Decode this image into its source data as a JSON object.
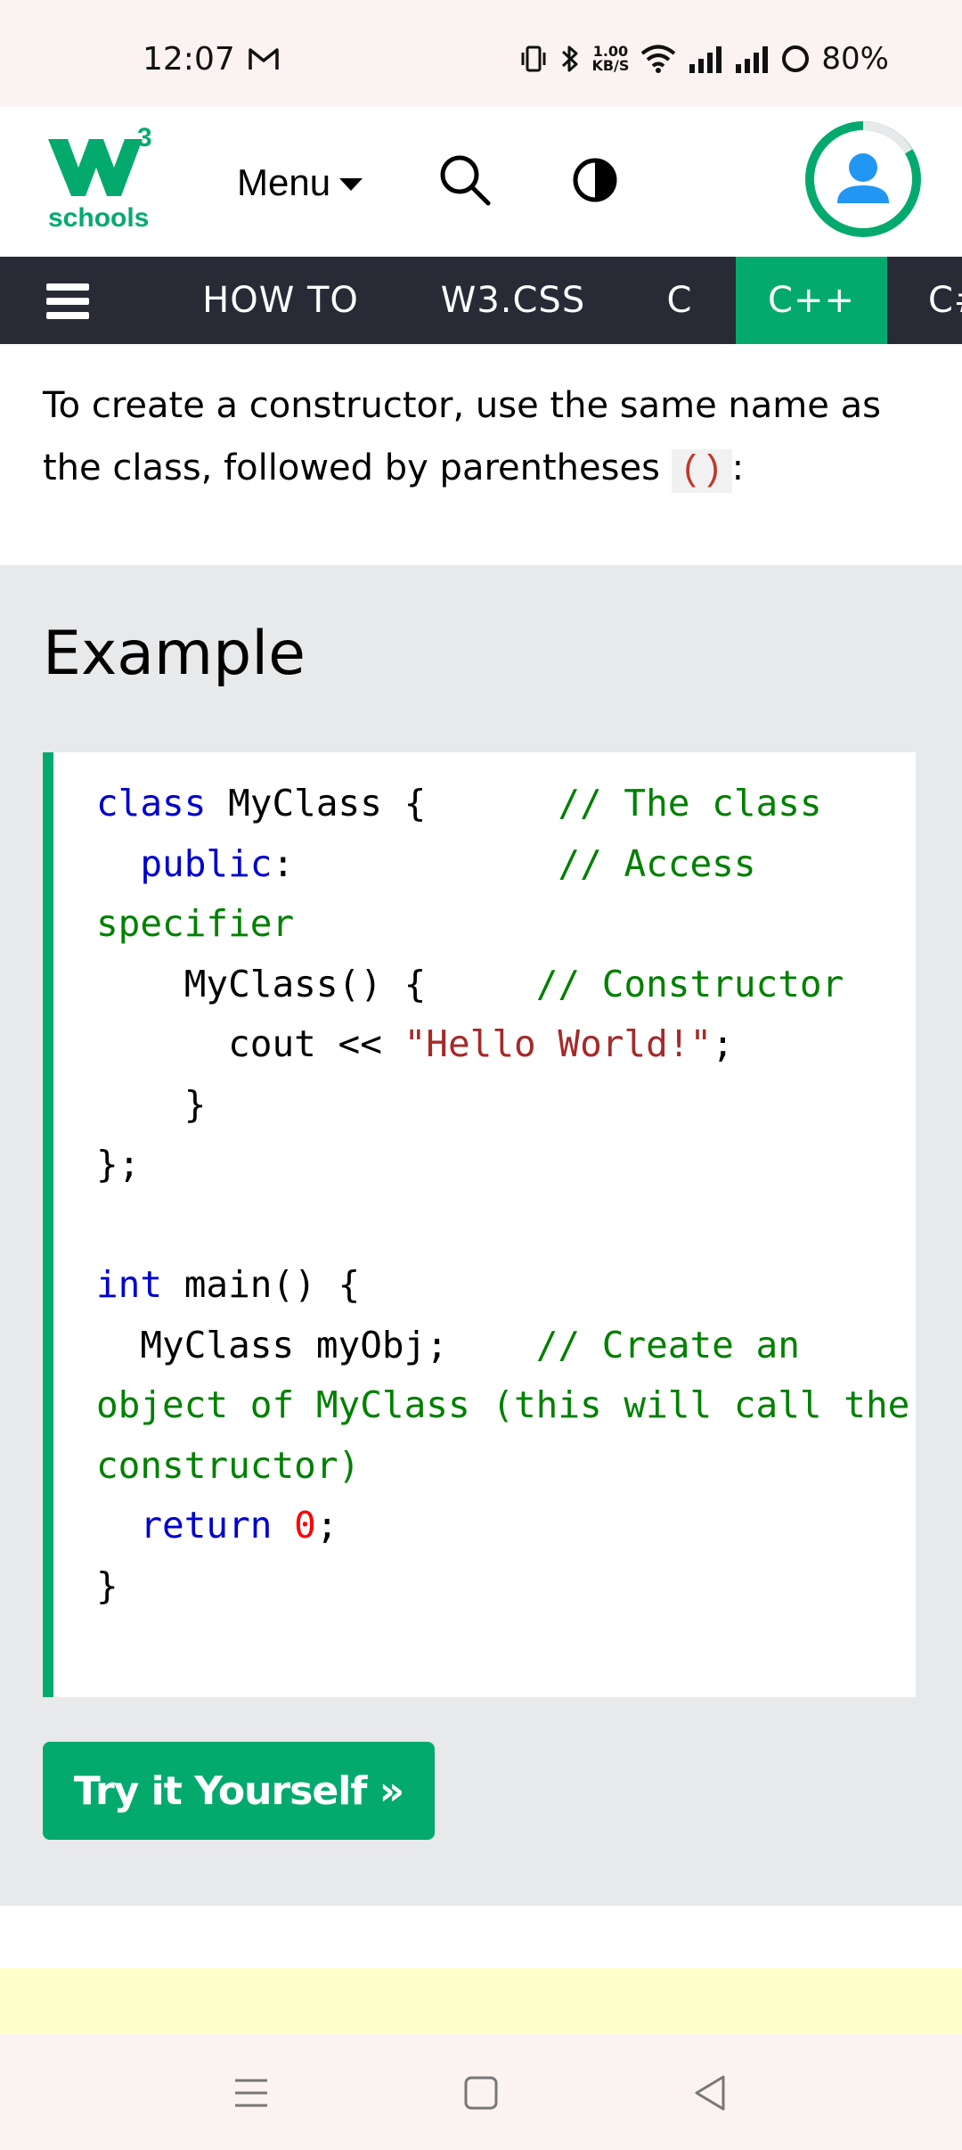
{
  "status_bar": {
    "time": "12:07",
    "net_speed_top": "1.00",
    "net_speed_bottom": "KB/S",
    "battery": "80%"
  },
  "header": {
    "logo_text": "schools",
    "logo_superscript": "3",
    "menu_label": "Menu"
  },
  "nav": {
    "items": [
      "HOW TO",
      "W3.CSS",
      "C",
      "C++",
      "C#"
    ],
    "active": "C++"
  },
  "intro": {
    "text_before": "To create a constructor, use the same name as the class, followed by parentheses ",
    "code": "()",
    "text_after": ":"
  },
  "example": {
    "title": "Example",
    "button_label": "Try it Yourself »"
  },
  "code_lines": {
    "l1_kw": "class",
    "l1_text": " MyClass {      ",
    "l1_cm": "// The class",
    "l2_indent": "  ",
    "l2_kw": "public",
    "l2_text": ":            ",
    "l2_cm": "// Access specifier",
    "l3_text": "    MyClass() {     ",
    "l3_cm": "// Constructor",
    "l4_text": "      cout << ",
    "l4_str": "\"Hello World!\"",
    "l4_end": ";",
    "l5_text": "    }",
    "l6_text": "};",
    "l8_kw": "int",
    "l8_text": " main() {",
    "l9_text": "  MyClass myObj;    ",
    "l9_cm": "// Create an object of MyClass (this will call the constructor)",
    "l10_indent": "  ",
    "l10_kw": "return",
    "l10_sp": " ",
    "l10_num": "0",
    "l10_end": ";",
    "l11_text": "}"
  },
  "colors": {
    "accent": "#04aa6d",
    "nav_bg": "#282a35",
    "panel_bg": "#e7e9eb",
    "keyword": "#0000cd",
    "comment": "#008000",
    "string": "#a52a2a",
    "number": "#ff0000"
  }
}
